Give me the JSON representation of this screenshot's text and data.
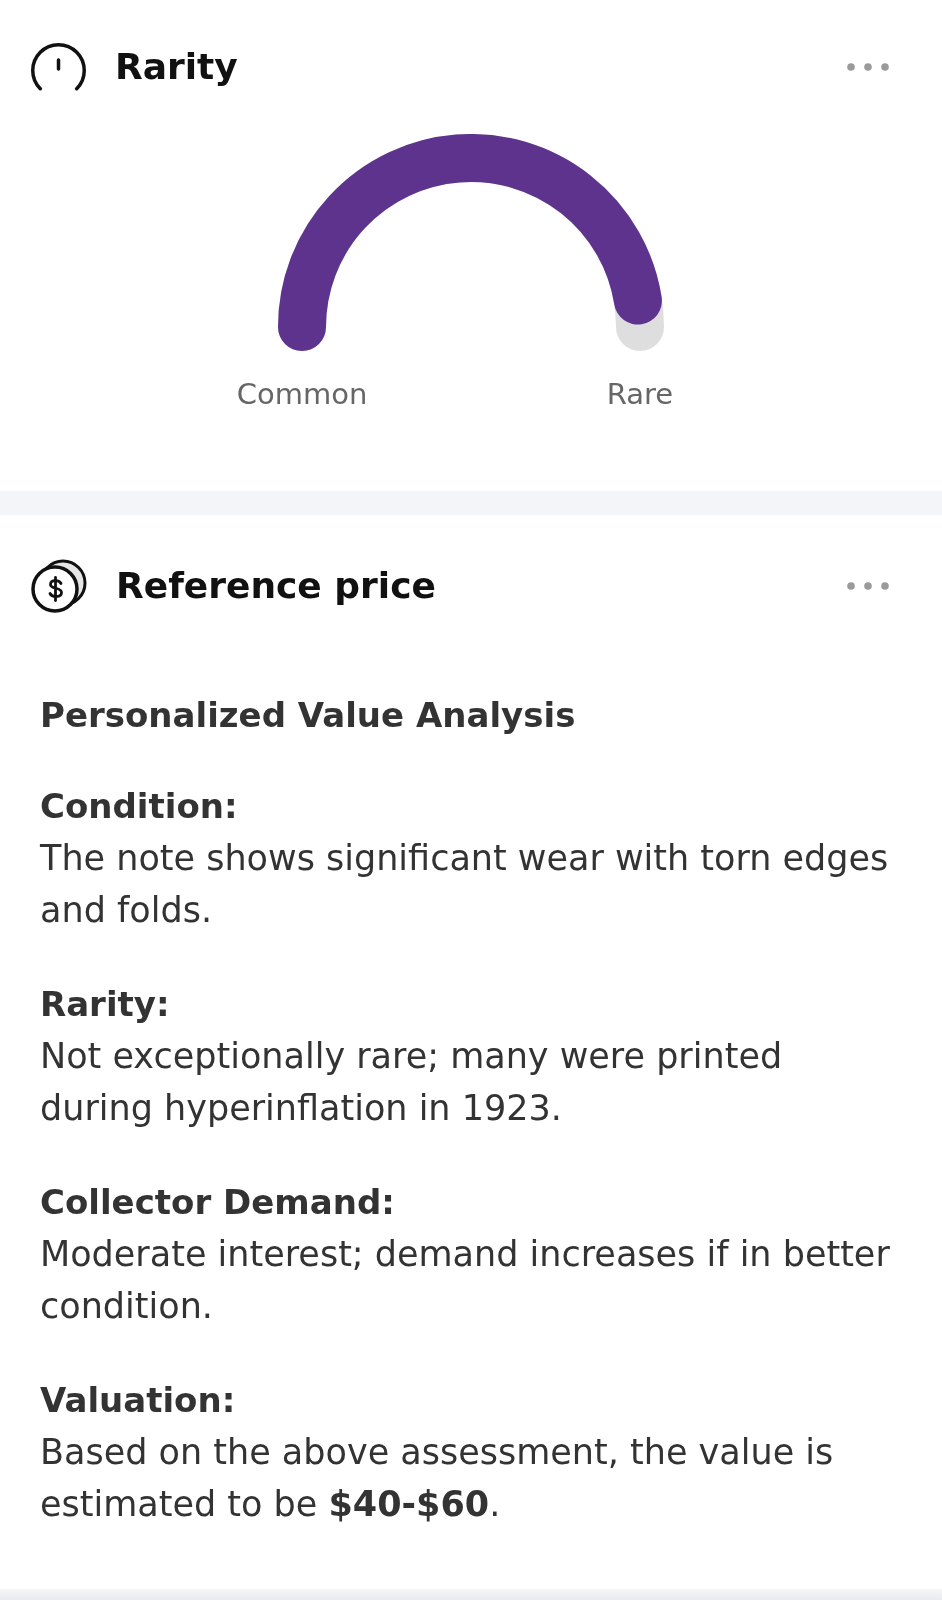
{
  "rarity": {
    "title": "Rarity",
    "gauge": {
      "level": 0.95,
      "min_label": "Common",
      "max_label": "Rare"
    }
  },
  "reference_price": {
    "title": "Reference price",
    "heading": "Personalized Value Analysis",
    "sections": [
      {
        "label": "Condition:",
        "text": "The note shows significant wear with torn edges and folds."
      },
      {
        "label": "Rarity:",
        "text": "Not exceptionally rare; many were printed during hyperinflation in 1923."
      },
      {
        "label": "Collector Demand:",
        "text": "Moderate interest; demand increases if in better condition."
      },
      {
        "label": "Valuation:",
        "text": "Based on the above assessment, the value is estimated to be **$40-$60**."
      }
    ]
  }
}
